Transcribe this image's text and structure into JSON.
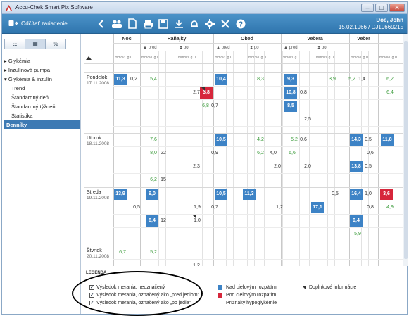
{
  "app": {
    "title": "Accu-Chek Smart Pix Software"
  },
  "toolbar": {
    "connect_label": "Odčítať zariadenie",
    "user_name": "Doe, John",
    "user_info": "15.02.1966 / DJ19669215"
  },
  "sidebar": {
    "view_tabs": [
      "☷",
      "▦",
      "%"
    ],
    "items": [
      {
        "label": "▸ Glykémia"
      },
      {
        "label": "▸ Inzulínová pumpa"
      },
      {
        "label": "▾ Glykémia & inzulín"
      },
      {
        "label": "Trend"
      },
      {
        "label": "Štandardný deň"
      },
      {
        "label": "Štandardný týždeň"
      },
      {
        "label": "Štatistika"
      },
      {
        "label": "Denníky"
      }
    ]
  },
  "grid": {
    "periods": [
      "Noc",
      "Raňajky",
      "Obed",
      "Večera",
      "Večer"
    ],
    "pre": "▲ pred",
    "post": "⧗ po",
    "units": "mmol/L  g  U",
    "days": [
      {
        "name": "Pondelok",
        "date": "17.11.2008"
      },
      {
        "name": "Utorok",
        "date": "18.11.2008"
      },
      {
        "name": "Streda",
        "date": "19.11.2008"
      },
      {
        "name": "Štvrtok",
        "date": "20.11.2008"
      }
    ],
    "cells": [
      {
        "v": "11,3",
        "t": "hi"
      },
      {
        "v": "0,2",
        "t": "k"
      },
      {
        "v": "5,4",
        "t": "g"
      },
      {
        "v": "10,4",
        "t": "hi"
      },
      {
        "v": "8,3",
        "t": "g"
      },
      {
        "v": "9,3",
        "t": "hi"
      },
      {
        "v": "3,9",
        "t": "g"
      },
      {
        "v": "5,2",
        "t": "g"
      },
      {
        "v": "1,4",
        "t": "k"
      },
      {
        "v": "6,2",
        "t": "g"
      },
      {
        "v": "2,7",
        "t": "k"
      },
      {
        "v": "3,8",
        "t": "lo"
      },
      {
        "v": "10,8",
        "t": "hi"
      },
      {
        "v": "0,8",
        "t": "k"
      },
      {
        "v": "6,4",
        "t": "g"
      },
      {
        "v": "6,8",
        "t": "g"
      },
      {
        "v": "0,7",
        "t": "k"
      },
      {
        "v": "8,5",
        "t": "hi"
      },
      {
        "v": "2,5",
        "t": "k"
      },
      {
        "v": "7,6",
        "t": "g"
      },
      {
        "v": "10,5",
        "t": "hi"
      },
      {
        "v": "4,2",
        "t": "g"
      },
      {
        "v": "5,2",
        "t": "g"
      },
      {
        "v": "0,6",
        "t": "k"
      },
      {
        "v": "14,3",
        "t": "hi"
      },
      {
        "v": "0,5",
        "t": "k"
      },
      {
        "v": "11,8",
        "t": "hi"
      },
      {
        "v": "8,0",
        "t": "g"
      },
      {
        "v": "22",
        "t": "k"
      },
      {
        "v": "0,9",
        "t": "k"
      },
      {
        "v": "6,2",
        "t": "g"
      },
      {
        "v": "4,0",
        "t": "k"
      },
      {
        "v": "6,6",
        "t": "g"
      },
      {
        "v": "0,6",
        "t": "k"
      },
      {
        "v": "2,3",
        "t": "k"
      },
      {
        "v": "2,0",
        "t": "k"
      },
      {
        "v": "2,0",
        "t": "k"
      },
      {
        "v": "13,8",
        "t": "hi"
      },
      {
        "v": "0,5",
        "t": "k"
      },
      {
        "v": "6,2",
        "t": "g"
      },
      {
        "v": "15",
        "t": "k"
      },
      {
        "v": "13,9",
        "t": "hi"
      },
      {
        "v": "9,0",
        "t": "hi"
      },
      {
        "v": "10,5",
        "t": "hi"
      },
      {
        "v": "11,3",
        "t": "hi"
      },
      {
        "v": "0,5",
        "t": "k"
      },
      {
        "v": "16,4",
        "t": "hi"
      },
      {
        "v": "1,0",
        "t": "k"
      },
      {
        "v": "3,6",
        "t": "lo"
      },
      {
        "v": "0,5",
        "t": "k"
      },
      {
        "v": "1,9",
        "t": "k"
      },
      {
        "v": "0,7",
        "t": "k"
      },
      {
        "v": "1,2",
        "t": "k"
      },
      {
        "v": "17,1",
        "t": "hi"
      },
      {
        "v": "0,8",
        "t": "k"
      },
      {
        "v": "4,9",
        "t": "g"
      },
      {
        "v": "8,4",
        "t": "hi"
      },
      {
        "v": "12",
        "t": "k"
      },
      {
        "v": "1,0",
        "t": "k"
      },
      {
        "v": "9,4",
        "t": "hi"
      },
      {
        "v": "5,9",
        "t": "g"
      },
      {
        "v": "6,7",
        "t": "g"
      },
      {
        "v": "5,2",
        "t": "g"
      },
      {
        "v": "1,2",
        "t": "k"
      }
    ]
  },
  "legend": {
    "title": "LEGENDA",
    "checks": [
      "Výsledok merania, neoznačený",
      "Výsledok merania, označený ako „pred jedlom“",
      "Výsledok merania, označený ako „po jedle“"
    ],
    "above": "Nad cieľovým rozpätím",
    "below": "Pod cieľovým rozpätím",
    "hypo": "Príznaky hypoglykémie",
    "info": "Doplnkové informácie",
    "color_above": "#3d83c6",
    "color_below": "#d6263b"
  }
}
